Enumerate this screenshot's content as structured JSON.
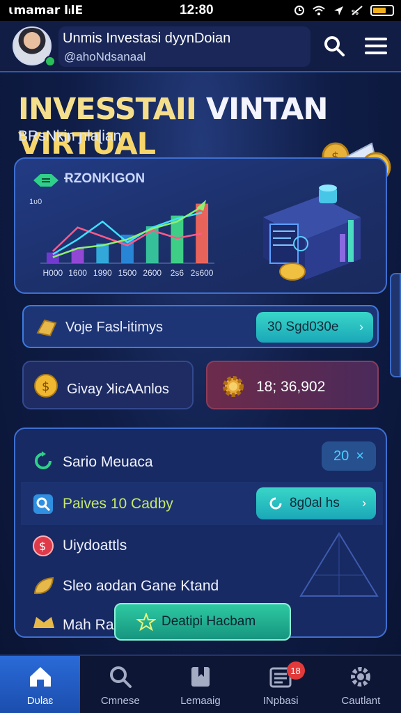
{
  "status_bar": {
    "carrier": "ɩmamar lᵢlE",
    "time": "12:80"
  },
  "header": {
    "name": "Unmis Investasi dyynDoian",
    "handle": "@ahoNdsanaal",
    "search_icon": "search-icon",
    "menu_icon": "menu-icon"
  },
  "hero": {
    "title_w1": "INVESSTAII",
    "title_w2": "VINTAN",
    "title_w3": "VIRTUAL",
    "subtitle": "BRsNkin ɲlaɭian"
  },
  "chart_card": {
    "title": "ɌZONKIGON",
    "y_label": "1ʋ0"
  },
  "chart_data": {
    "type": "bar",
    "title": "ɌZONKIGON",
    "categories": [
      "H000",
      "1600",
      "1990",
      "1500",
      "2600",
      "2s6",
      "2s600"
    ],
    "values": [
      18,
      25,
      33,
      48,
      62,
      80,
      100
    ],
    "series_colors": [
      "#7a3bd8",
      "#a04ae0",
      "#35b6e6",
      "#2a8ee0",
      "#3ad0a0",
      "#44e08a",
      "#ff6a5a"
    ],
    "lines": [
      {
        "name": "",
        "color": "#ff5a8a",
        "values": [
          20,
          60,
          45,
          30,
          55,
          42,
          50
        ]
      },
      {
        "name": "",
        "color": "#3fe0ff",
        "values": [
          15,
          40,
          70,
          35,
          60,
          75,
          85
        ]
      },
      {
        "name": "",
        "color": "#8cf070",
        "values": [
          10,
          25,
          30,
          40,
          58,
          70,
          95
        ]
      }
    ],
    "ylim": [
      0,
      110
    ]
  },
  "promo": {
    "label": "Voje  Fasl-itimys",
    "button": "30 Sgd030e",
    "chevron": "›"
  },
  "stats": {
    "left_label": "Givay ꞰicAAnlos",
    "right_value": "18; 36,902"
  },
  "list_card": {
    "header_label": "Sario Meuaca",
    "badge_value": "20",
    "badge_close": "×",
    "rows": [
      {
        "label": "Paives 10 Cadby",
        "button": "8g0al hs"
      },
      {
        "label": "Uiydoattls"
      },
      {
        "label": "Sleo aodan Gane Ktand"
      },
      {
        "label": "Mah Ra"
      }
    ]
  },
  "overlay_button": {
    "label": "Deatipi Hacbam"
  },
  "bottom_nav": {
    "items": [
      {
        "label": "Dᴜlaɛ",
        "icon": "home-icon"
      },
      {
        "label": "Cmnese",
        "icon": "search-icon"
      },
      {
        "label": "Lemaaig",
        "icon": "bookmark-icon"
      },
      {
        "label": "INpbasi",
        "icon": "news-icon",
        "badge": "18"
      },
      {
        "label": "Cautlant",
        "icon": "gear-icon"
      }
    ]
  }
}
